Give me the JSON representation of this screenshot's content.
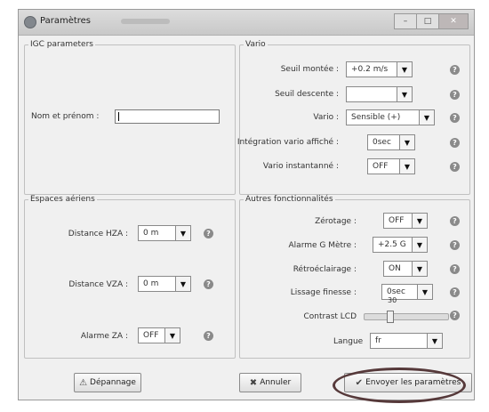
{
  "window": {
    "title": "Paramètres",
    "controls": {
      "minimize": "–",
      "maximize": "□",
      "close": "✕"
    }
  },
  "igc": {
    "legend": "IGC parameters",
    "name_label": "Nom et prénom :",
    "name_value": ""
  },
  "vario": {
    "legend": "Vario",
    "rows": [
      {
        "label": "Seuil montée :",
        "value": "+0.2 m/s"
      },
      {
        "label": "Seuil descente :",
        "value": ""
      },
      {
        "label": "Vario :",
        "value": "Sensible (+)"
      },
      {
        "label": "Intégration vario affiché :",
        "value": "0sec"
      },
      {
        "label": "Vario instantanné :",
        "value": "OFF"
      }
    ]
  },
  "airspace": {
    "legend": "Espaces aériens",
    "rows": [
      {
        "label": "Distance HZA :",
        "value": "0 m"
      },
      {
        "label": "Distance VZA :",
        "value": "0 m"
      },
      {
        "label": "Alarme ZA :",
        "value": "OFF"
      }
    ]
  },
  "other": {
    "legend": "Autres fonctionnalités",
    "rows": [
      {
        "label": "Zérotage :",
        "value": "OFF"
      },
      {
        "label": "Alarme G Mètre :",
        "value": "+2.5 G"
      },
      {
        "label": "Rétroéclairage :",
        "value": "ON"
      },
      {
        "label": "Lissage finesse :",
        "value": "0sec"
      }
    ],
    "contrast_label": "Contrast LCD",
    "contrast_value": "30",
    "contrast_fraction": 0.3,
    "language_label": "Langue",
    "language_value": "fr"
  },
  "help_glyph": "?",
  "combo_arrow": "▼",
  "buttons": {
    "troubleshoot": "Dépannage",
    "cancel": "Annuler",
    "send": "Envoyer les paramètres"
  },
  "icons": {
    "troubleshoot": "⚠",
    "cancel": "✖",
    "send": "✔",
    "help": "help-icon"
  },
  "colors": {
    "highlight": "#d8151f"
  }
}
